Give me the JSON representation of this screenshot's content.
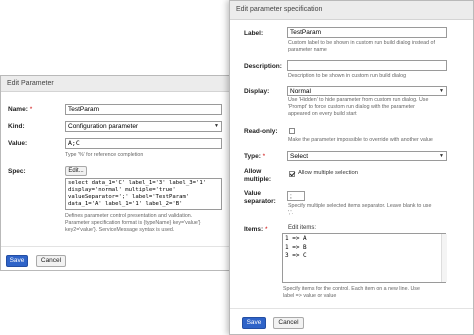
{
  "left": {
    "title": "Edit Parameter",
    "name_label": "Name:",
    "name_value": "TestParam",
    "kind_label": "Kind:",
    "kind_value": "Configuration parameter",
    "value_label": "Value:",
    "value_value": "A;C",
    "value_note": "Type '%' for reference completion",
    "spec_label": "Spec:",
    "edit_button": "Edit...",
    "spec_text": "select data_1='C' label_1='3' label_3='1'\ndisplay='normal' multiple='true'\nvalueSeparator=';' label='TestParam'\ndata_1='A' label_1='1' label_2='B'",
    "spec_note_1": "Defines parameter control presentation and validation.",
    "spec_note_2": "Parameter specification format is {typeName} key='value'}",
    "spec_note_3": "key2='value'}. ServiceMessage syntax is used.",
    "save": "Save",
    "cancel": "Cancel"
  },
  "right": {
    "title": "Edit parameter specification",
    "label_label": "Label:",
    "label_value": "TestParam",
    "label_note_1": "Custom label to be shown in custom run build dialog instead of",
    "label_note_2": "parameter name",
    "desc_label": "Description:",
    "desc_value": "",
    "desc_note": "Description to be shown in custom run build dialog",
    "display_label": "Display:",
    "display_value": "Normal",
    "display_note_1": "Use 'Hidden' to hide parameter from custom run dialog. Use",
    "display_note_2": "'Prompt' to force custom run dialog with the parameter",
    "display_note_3": "appeared on every build start",
    "readonly_label": "Read-only:",
    "readonly_note": "Make the parameter impossible to override with another value",
    "type_label": "Type:",
    "type_value": "Select",
    "allow_label_1": "Allow",
    "allow_label_2": "multiple:",
    "allow_text": "Allow multiple selection",
    "valsep_label_1": "Value",
    "valsep_label_2": "separator:",
    "valsep_value": ";",
    "valsep_note_1": "Specify multiple selected items separator. Leave blank to use",
    "valsep_note_2": "','.",
    "items_label": "Items:",
    "items_title": "Edit items:",
    "items_text": "1 => A\n1 => B\n3 => C",
    "items_note_1": "Specify items for the control. Each item on a new line. Use",
    "items_note_2": "label => value or value",
    "save": "Save",
    "cancel": "Cancel"
  }
}
